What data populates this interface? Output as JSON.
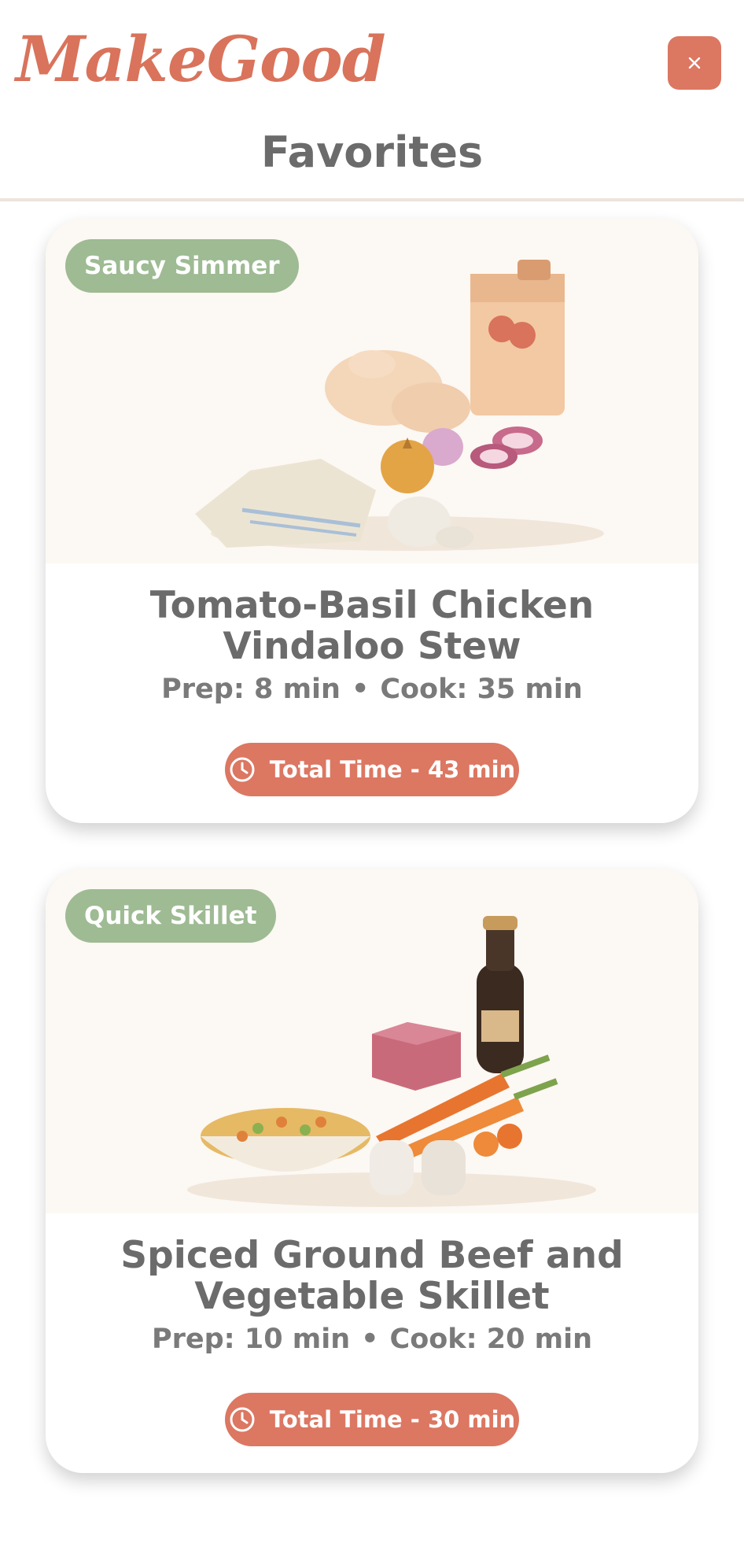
{
  "header": {
    "logo": "MakeGood",
    "close_label": "×",
    "title": "Favorites"
  },
  "recipes": [
    {
      "tag": "Saucy Simmer",
      "title": "Tomato-Basil Chicken Vindaloo Stew",
      "prep": "Prep: 8 min",
      "cook": "Cook: 35 min",
      "total": "Total Time - 43 min",
      "image": "chicken, onions, garlic, tomato carton, towel"
    },
    {
      "tag": "Quick Skillet",
      "title": "Spiced Ground Beef and Vegetable Skillet",
      "prep": "Prep: 10 min",
      "cook": "Cook: 20 min",
      "total": "Total Time - 30 min",
      "image": "ground beef, soy sauce bottle, carrots, mixed vegetables, salt and pepper"
    }
  ],
  "separator": "•",
  "colors": {
    "accent": "#dc7762",
    "tag": "#9ebb93",
    "text": "#6b6b6b"
  }
}
